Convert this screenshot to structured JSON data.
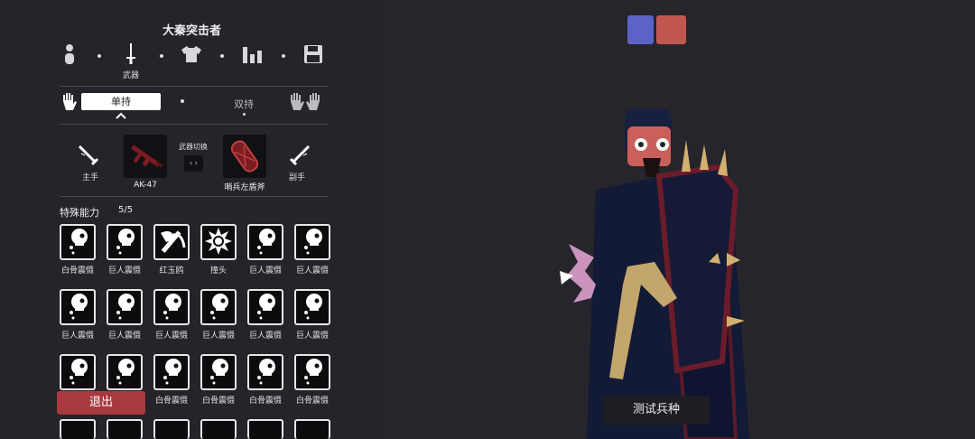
{
  "unit_name": "大秦突击者",
  "topnav": {
    "weapon_label": "武器",
    "items": [
      "body-icon",
      "sword-icon",
      "shirt-icon",
      "stats-icon",
      "save-icon"
    ]
  },
  "hand_mode": {
    "single": "单持",
    "dual": "双持"
  },
  "weapons": {
    "main_hand_label": "主手",
    "off_hand_label": "副手",
    "switch_label": "武器切换",
    "switch_key": "‹ ›",
    "primary_name": "AK-47",
    "secondary_name": "哨兵左盾斧"
  },
  "abilities": {
    "heading": "特殊能力",
    "count": "5/5",
    "rows": [
      [
        {
          "label": "白骨震慑",
          "icon": "skull-icon"
        },
        {
          "label": "巨人震慑",
          "icon": "skull-icon"
        },
        {
          "label": "红玉鸥",
          "icon": "axe-icon"
        },
        {
          "label": "撞头",
          "icon": "burst-skull-icon"
        },
        {
          "label": "巨人震慑",
          "icon": "skull-icon"
        },
        {
          "label": "巨人震慑",
          "icon": "skull-icon"
        }
      ],
      [
        {
          "label": "巨人震慑",
          "icon": "skull-icon"
        },
        {
          "label": "巨人震慑",
          "icon": "skull-icon"
        },
        {
          "label": "巨人震慑",
          "icon": "skull-icon"
        },
        {
          "label": "巨人震慑",
          "icon": "skull-icon"
        },
        {
          "label": "巨人震慑",
          "icon": "skull-icon"
        },
        {
          "label": "巨人震慑",
          "icon": "skull-icon"
        }
      ],
      [
        {
          "label": "",
          "icon": "skull-icon"
        },
        {
          "label": "",
          "icon": "skull-icon"
        },
        {
          "label": "白骨震慑",
          "icon": "skull-icon"
        },
        {
          "label": "白骨震慑",
          "icon": "skull-icon"
        },
        {
          "label": "白骨震慑",
          "icon": "skull-icon"
        },
        {
          "label": "白骨震慑",
          "icon": "skull-icon"
        }
      ]
    ]
  },
  "exit_label": "退出",
  "test_label": "测试兵种",
  "colors": {
    "team_blue": "#5b63c8",
    "team_red": "#c05850",
    "accent": "#a83a3f"
  }
}
